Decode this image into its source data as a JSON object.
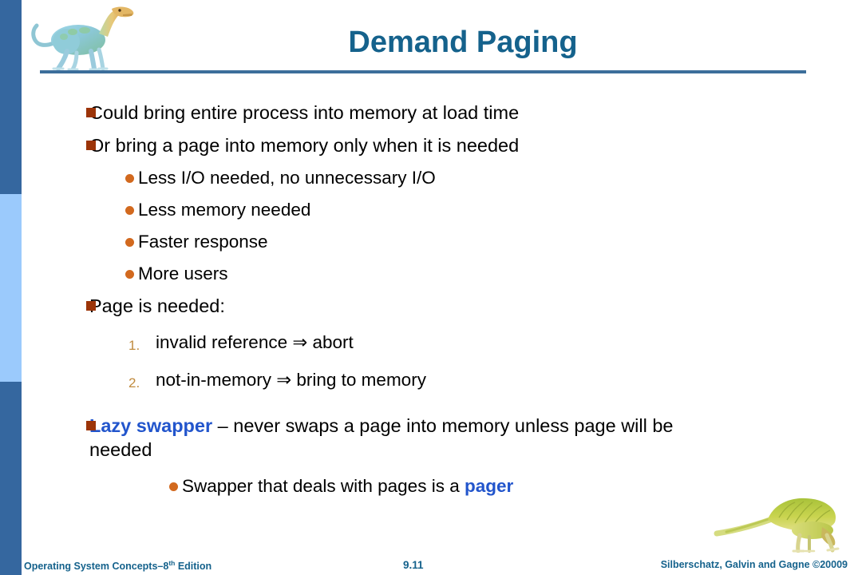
{
  "slide": {
    "title": "Demand Paging",
    "accent_color": "#15628C",
    "rule_color": "#3C6E9B",
    "stripe_dark_color": "#35679F",
    "stripe_light_color": "#9BCAFC",
    "square_bullet_color": "#9C3408",
    "round_bullet_color": "#D2691E",
    "number_color": "#C08B3E",
    "highlight_color": "#2255CC"
  },
  "logos": {
    "top_left_icon": "dinosaur-icon",
    "bottom_right_icon": "dinosaur-icon"
  },
  "body": {
    "b1": "Could bring entire process into memory at load time",
    "b2": "Or bring a page into memory only when it is needed",
    "s1": "Less I/O needed, no unnecessary I/O",
    "s2": "Less memory needed",
    "s3": "Faster response",
    "s4": "More users",
    "b3": "Page is needed:",
    "n1_marker": "1.",
    "n1": "invalid reference ⇒ abort",
    "n2_marker": "2.",
    "n2": "not-in-memory ⇒ bring to memory",
    "b4_highlight": "Lazy swapper",
    "b4_rest": " – never swaps a page into memory unless page will be",
    "b4_wrap": "needed",
    "s5_pre": "Swapper that deals with pages is a ",
    "s5_highlight": "pager"
  },
  "footer": {
    "left_main": "Operating System Concepts–8",
    "left_sup": "th",
    "left_tail": " Edition",
    "page": "9.11",
    "right": "Silberschatz, Galvin and Gagne ©20009"
  }
}
